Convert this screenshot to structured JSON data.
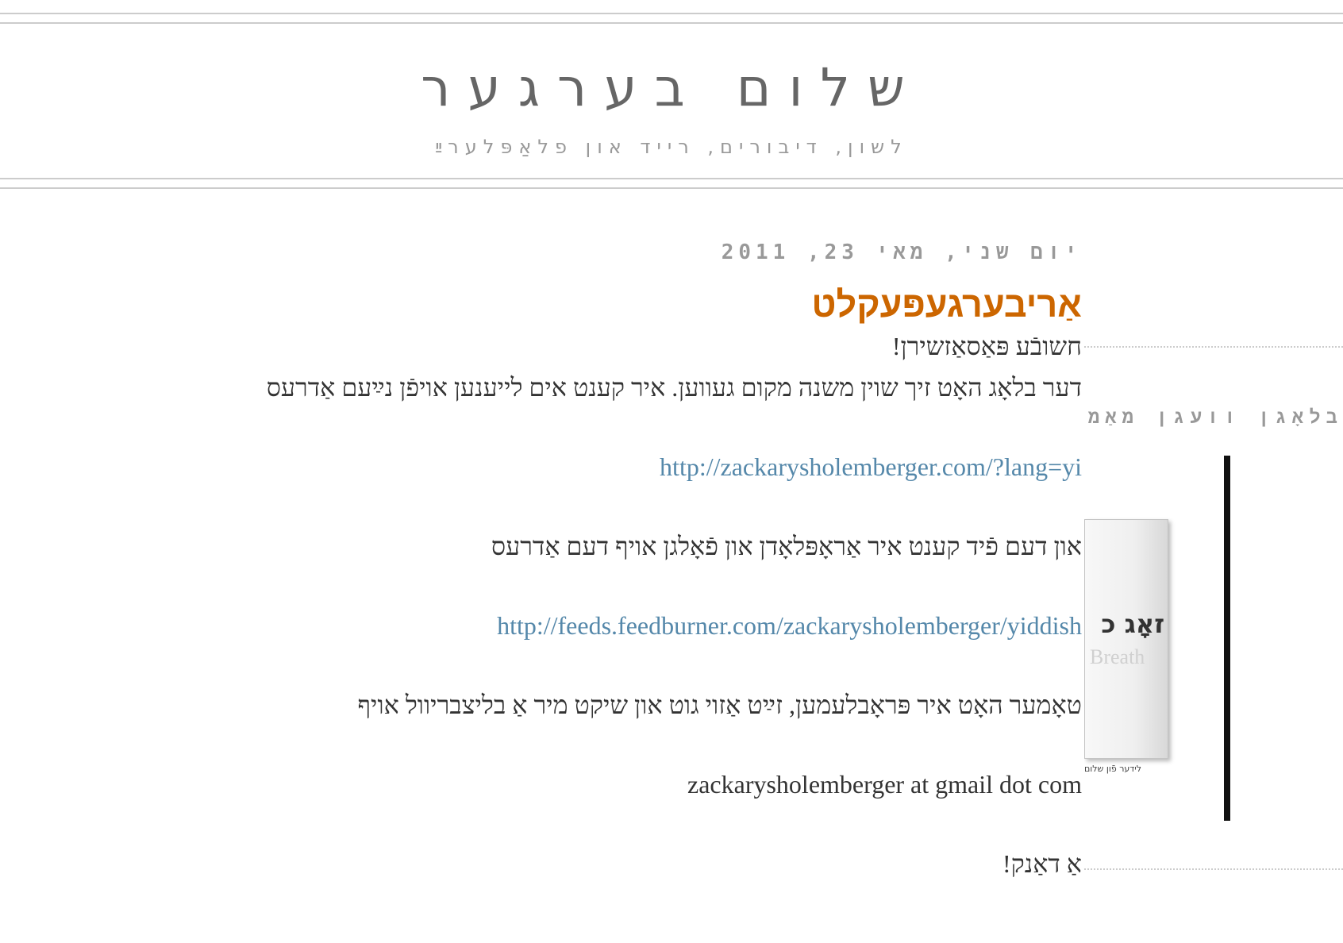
{
  "header": {
    "title": "שלום בערגער",
    "description": "לשון, דיבורים, רייד און פלאַפּלערײַ"
  },
  "post": {
    "date": "יום שני, מאי 23, 2011",
    "title": "אַריבערגעפּעקלט",
    "body": {
      "line1": "חשובֿע פּאַסאַזשירן!",
      "line2": "דער בלאָג האָט זיך שוין משנה מקום געווען. איר קענט אים לייענען אויפֿן נײַעם אַדרעס",
      "link1": "http://zackarysholemberger.com/?lang=yi",
      "line3": "און דעם פֿיד קענט איר אַראָפּלאָדן און פֿאָלגן אויף דעם אַדרעס",
      "link2": "http://feeds.feedburner.com/zackarysholemberger/yiddish",
      "line4": "טאָמער האָט איר פּראָבלעמען, זײַט אַזוי גוט און שיקט מיר אַ בליצבריוול אויף",
      "email": "zackarysholemberger at gmail dot com",
      "line5": "אַ דאַנק!"
    }
  },
  "sidebar": {
    "widget_title": "בלאָגן וועגן מאַמע-לשון און אויף ייִדיש",
    "book": {
      "title": "זאָג כ",
      "subtitle": "Breath",
      "caption": "לידער פֿון שלום"
    }
  }
}
